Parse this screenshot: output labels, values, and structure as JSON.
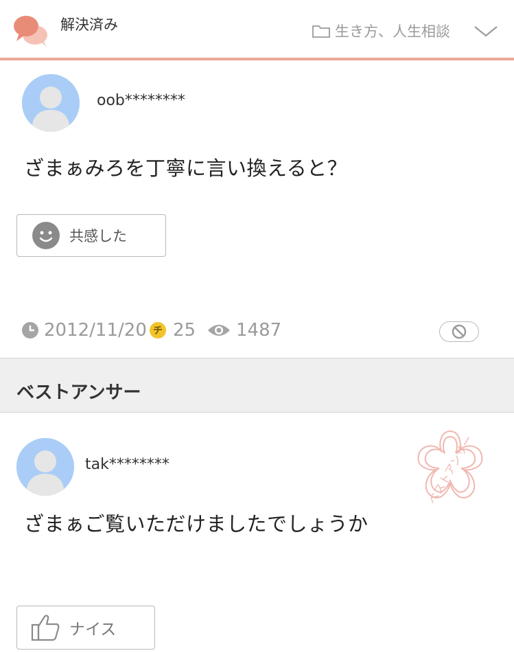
{
  "header": {
    "status": "解決済み",
    "category": "生き方、人生相談"
  },
  "question": {
    "username": "oob********",
    "text": "ざまぁみろを丁寧に言い換えると？",
    "empathy_label": "共感した",
    "date": "2012/11/20",
    "coin_symbol": "チ",
    "coins": "25",
    "views": "1487"
  },
  "best_answer": {
    "section_title": "ベストアンサー",
    "username": "tak********",
    "text": "ざまぁご覧いただけましたでしょうか",
    "nice_label": "ナイス",
    "stamp_text": "ベストアンサー"
  },
  "colors": {
    "accent_line": "#eba79a",
    "avatar_bg": "#a9cdf6",
    "coin": "#f1c42c",
    "stamp": "#f0b7b0"
  },
  "icons": [
    "chat-bubbles-icon",
    "folder-icon",
    "chevron-down-icon",
    "user-avatar-icon",
    "smiley-icon",
    "clock-icon",
    "coin-icon",
    "eye-icon",
    "block-icon",
    "best-answer-stamp-icon",
    "thumbs-up-icon"
  ]
}
